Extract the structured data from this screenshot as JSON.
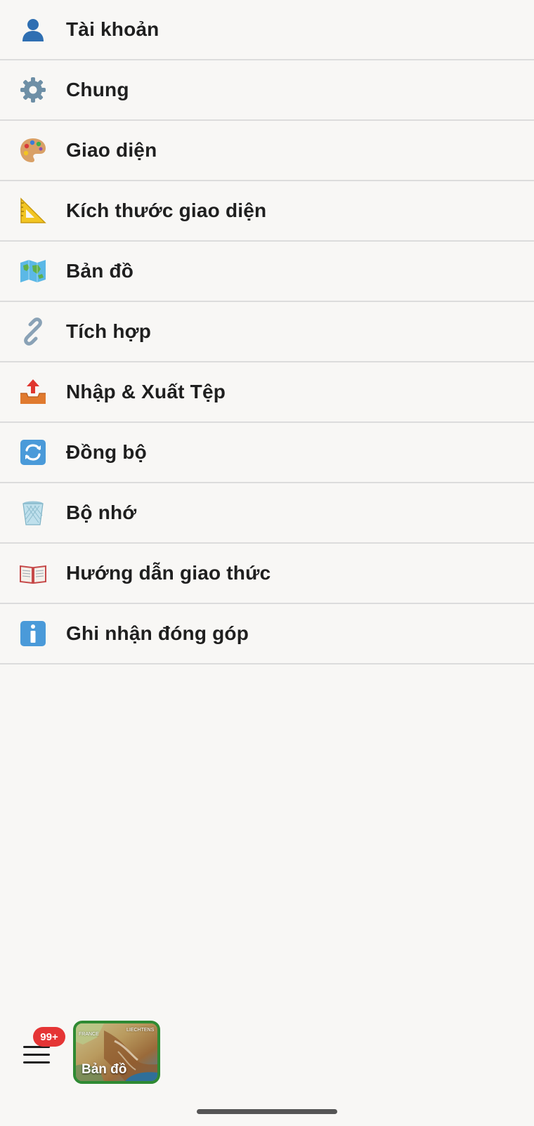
{
  "menu": {
    "items": [
      {
        "label": "Tài khoản",
        "icon": "person-icon"
      },
      {
        "label": "Chung",
        "icon": "gear-icon"
      },
      {
        "label": "Giao diện",
        "icon": "palette-icon"
      },
      {
        "label": "Kích thước giao diện",
        "icon": "triangular-ruler-icon"
      },
      {
        "label": "Bản đồ",
        "icon": "world-map-icon"
      },
      {
        "label": "Tích hợp",
        "icon": "link-icon"
      },
      {
        "label": "Nhập & Xuất Tệp",
        "icon": "outbox-tray-icon"
      },
      {
        "label": "Đồng bộ",
        "icon": "sync-arrows-icon"
      },
      {
        "label": "Bộ nhớ",
        "icon": "wastebasket-icon"
      },
      {
        "label": "Hướng dẫn giao thức",
        "icon": "open-book-icon"
      },
      {
        "label": "Ghi nhận đóng góp",
        "icon": "information-icon"
      }
    ]
  },
  "bottom_bar": {
    "menu_icon": "hamburger-menu-icon",
    "badge": "99+",
    "badge_color": "#e53535",
    "map_tile": {
      "label": "Bản đồ",
      "corner_label_left": "FRANCE",
      "corner_label_right": "LIECHTENS",
      "border_color": "#2f8a33"
    }
  }
}
